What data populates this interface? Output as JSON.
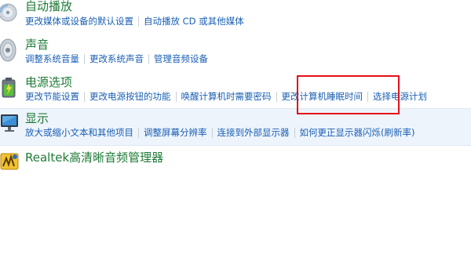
{
  "categories": [
    {
      "title": "自动播放",
      "icon": "autoplay-disc-icon",
      "links": [
        "更改媒体或设备的默认设置",
        "自动播放 CD 或其他媒体"
      ]
    },
    {
      "title": "声音",
      "icon": "speaker-icon",
      "links": [
        "调整系统音量",
        "更改系统声音",
        "管理音频设备"
      ]
    },
    {
      "title": "电源选项",
      "icon": "battery-icon",
      "links": [
        "更改节能设置",
        "更改电源按钮的功能",
        "唤醒计算机时需要密码",
        "更改计算机睡眠时间",
        "选择电源计划"
      ]
    },
    {
      "title": "显示",
      "icon": "monitor-icon",
      "links": [
        "放大或缩小文本和其他项目",
        "调整屏幕分辨率",
        "连接到外部显示器",
        "如何更正显示器闪烁(刷新率)"
      ]
    },
    {
      "title": "Realtek高清晰音频管理器",
      "icon": "realtek-audio-icon",
      "links": []
    }
  ],
  "highlight_color": "#e3101b"
}
